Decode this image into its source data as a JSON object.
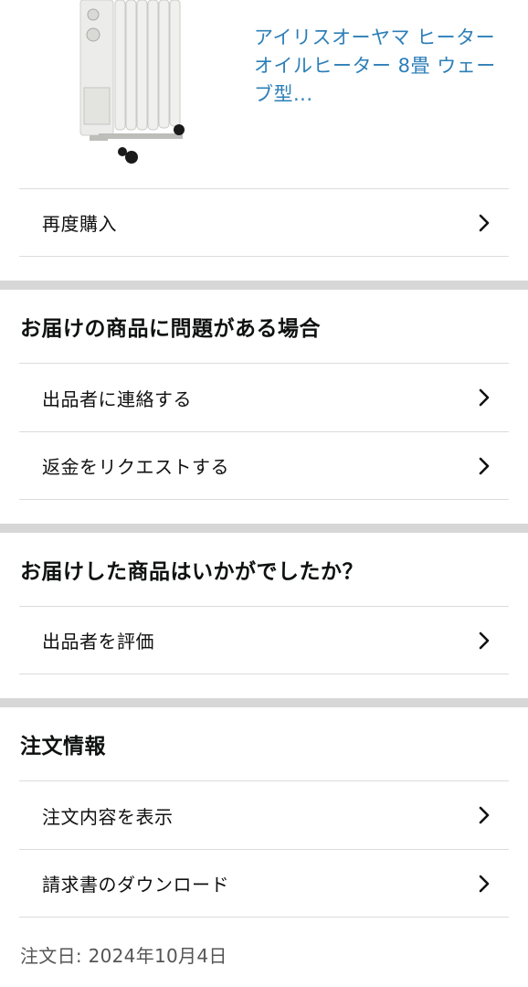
{
  "product": {
    "title": "アイリスオーヤマ ヒーター オイルヒーター 8畳 ウェーブ型...",
    "image_icon": "oil-heater-image"
  },
  "actions": {
    "buy_again": "再度購入"
  },
  "problem_section": {
    "title": "お届けの商品に問題がある場合",
    "items": [
      {
        "label": "出品者に連絡する"
      },
      {
        "label": "返金をリクエストする"
      }
    ]
  },
  "feedback_section": {
    "title": "お届けした商品はいかがでしたか？",
    "items": [
      {
        "label": "出品者を評価"
      }
    ]
  },
  "order_section": {
    "title": "注文情報",
    "items": [
      {
        "label": "注文内容を表示"
      },
      {
        "label": "請求書のダウンロード"
      }
    ],
    "order_date": "注文日: 2024年10月4日"
  },
  "icons": {
    "chevron": "chevron-right-icon"
  },
  "colors": {
    "link": "#2d7fb8",
    "divider": "#d7d7d7",
    "border": "#dcdcdc"
  }
}
